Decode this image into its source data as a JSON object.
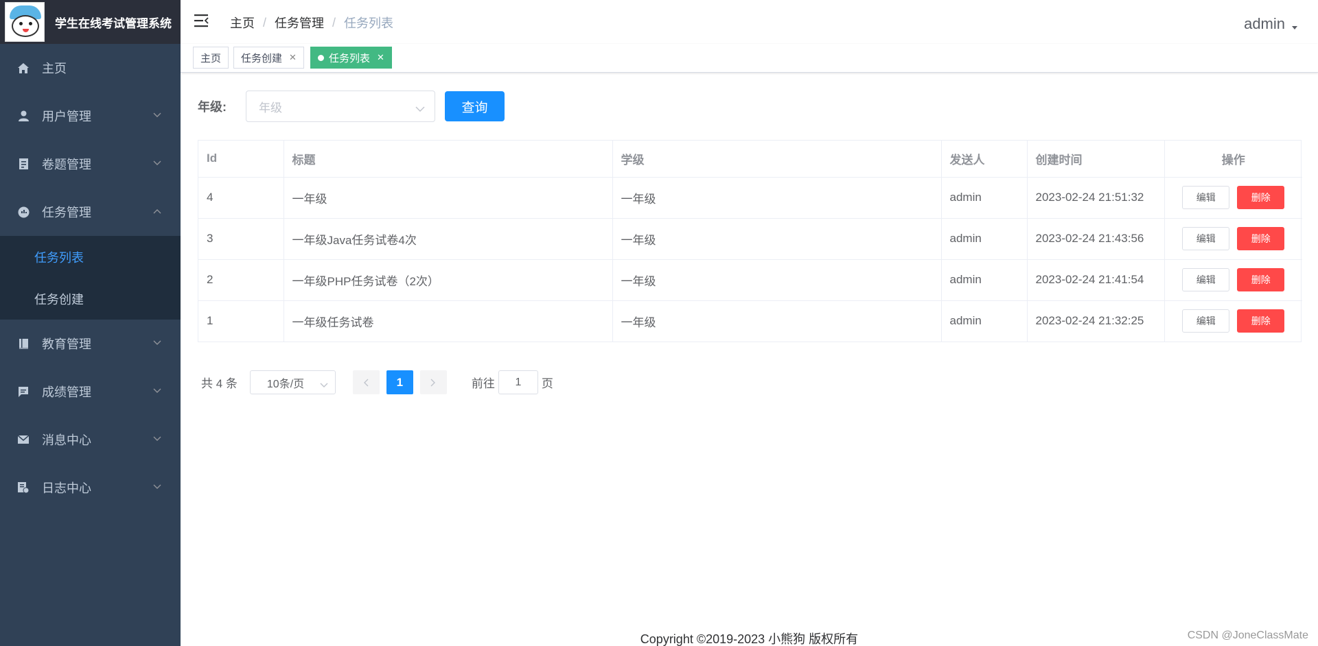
{
  "app": {
    "title": "学生在线考试管理系统"
  },
  "sidebar": {
    "items": [
      {
        "label": "主页",
        "icon": "home-icon",
        "expandable": false
      },
      {
        "label": "用户管理",
        "icon": "user-icon",
        "expandable": true
      },
      {
        "label": "卷题管理",
        "icon": "paper-icon",
        "expandable": true
      },
      {
        "label": "任务管理",
        "icon": "task-icon",
        "expandable": true,
        "expanded": true
      },
      {
        "label": "教育管理",
        "icon": "book-icon",
        "expandable": true
      },
      {
        "label": "成绩管理",
        "icon": "chat-icon",
        "expandable": true
      },
      {
        "label": "消息中心",
        "icon": "mail-icon",
        "expandable": true
      },
      {
        "label": "日志中心",
        "icon": "log-icon",
        "expandable": true
      }
    ],
    "task_submenu": [
      {
        "label": "任务列表",
        "active": true
      },
      {
        "label": "任务创建",
        "active": false
      }
    ]
  },
  "header": {
    "breadcrumb": [
      "主页",
      "任务管理",
      "任务列表"
    ],
    "user": "admin"
  },
  "tags": [
    {
      "label": "主页",
      "closable": false,
      "active": false
    },
    {
      "label": "任务创建",
      "closable": true,
      "active": false
    },
    {
      "label": "任务列表",
      "closable": true,
      "active": true
    }
  ],
  "filter": {
    "label": "年级:",
    "grade_placeholder": "年级",
    "query_button": "查询"
  },
  "table": {
    "columns": [
      "Id",
      "标题",
      "学级",
      "发送人",
      "创建时间",
      "操作"
    ],
    "rows": [
      {
        "id": "4",
        "title": "一年级",
        "grade": "一年级",
        "sender": "admin",
        "created": "2023-02-24 21:51:32"
      },
      {
        "id": "3",
        "title": "一年级Java任务试卷4次",
        "grade": "一年级",
        "sender": "admin",
        "created": "2023-02-24 21:43:56"
      },
      {
        "id": "2",
        "title": "一年级PHP任务试卷（2次）",
        "grade": "一年级",
        "sender": "admin",
        "created": "2023-02-24 21:41:54"
      },
      {
        "id": "1",
        "title": "一年级任务试卷",
        "grade": "一年级",
        "sender": "admin",
        "created": "2023-02-24 21:32:25"
      }
    ],
    "edit_label": "编辑",
    "delete_label": "删除"
  },
  "pagination": {
    "total": "共 4 条",
    "page_size": "10条/页",
    "current_page": "1",
    "goto_prefix": "前往",
    "goto_value": "1",
    "goto_suffix": "页"
  },
  "footer": {
    "copyright": "Copyright ©2019-2023 小熊狗 版权所有"
  },
  "watermark": "CSDN @JoneClassMate",
  "colors": {
    "sidebar_bg": "#304156",
    "submenu_bg": "#1f2d3d",
    "active_link": "#409eff",
    "primary": "#1890ff",
    "tag_active": "#42b983",
    "danger": "#ff4949"
  }
}
